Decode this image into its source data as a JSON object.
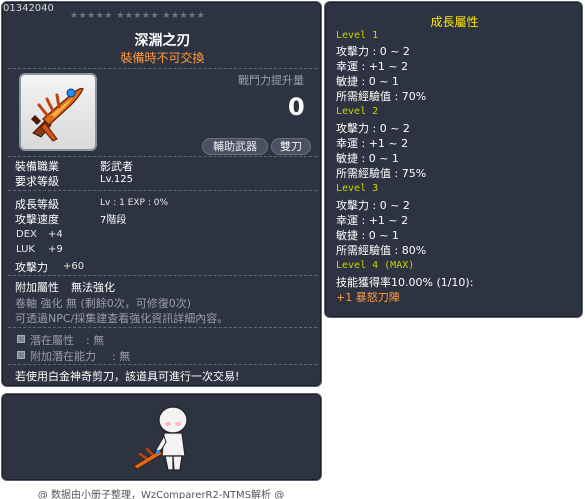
{
  "item": {
    "code": "01342040",
    "stars": "★★★★★  ★★★★★  ★★★★★",
    "name": "深淵之刃",
    "trade_note": "裝備時不可交換",
    "power_label": "戰鬥力提升量",
    "power_value": "0",
    "tag_sub": "輔助武器",
    "tag_type": "雙刀"
  },
  "requirements": {
    "job_label": "裝備職業",
    "job_value": "影武者",
    "level_label": "要求等級",
    "level_value": "Lv.125"
  },
  "stats": {
    "growth_label": "成長等級",
    "growth_value": "Lv : 1  EXP : 0%",
    "speed_label": "攻擊速度",
    "speed_value": "7階段",
    "dex_label": "DEX",
    "dex_value": "+4",
    "luk_label": "LUK",
    "luk_value": "+9",
    "atk_label": "攻擊力",
    "atk_value": "+60"
  },
  "extra": {
    "flame_label": "附加屬性",
    "flame_value": "無法強化",
    "scroll_line": "卷軸 強化 無 (剩餘0次，可修復0次)",
    "info_line": "可透過NPC/採集建查看強化資訊詳細內容。",
    "potential_label": "潛在屬性",
    "potential_value": ": 無",
    "addpot_label": "附加潛在能力",
    "addpot_value": ": 無",
    "trade_hint": "若使用白金神奇剪刀，該道具可進行一次交易!"
  },
  "growth": {
    "title": "成長屬性",
    "levels": [
      {
        "label": "Level 1",
        "lines": [
          "攻擊力 : 0 ~ 2",
          "幸運 : +1 ~ 2",
          "敏捷 : 0 ~ 1",
          "所需經驗值 : 70%"
        ]
      },
      {
        "label": "Level 2",
        "lines": [
          "攻擊力 : 0 ~ 2",
          "幸運 : +1 ~ 2",
          "敏捷 : 0 ~ 1",
          "所需經驗值 : 75%"
        ]
      },
      {
        "label": "Level 3",
        "lines": [
          "攻擊力 : 0 ~ 2",
          "幸運 : +1 ~ 2",
          "敏捷 : 0 ~ 1",
          "所需經驗值 : 80%"
        ]
      },
      {
        "label": "Level 4 (MAX)",
        "lines": [
          "技能獲得率10.00% (1/10):"
        ]
      }
    ],
    "skill": "+1 暴怒刀陣"
  },
  "footer": "@ 数据由小册子整理，WzComparerR2-NTMS解析 @"
}
